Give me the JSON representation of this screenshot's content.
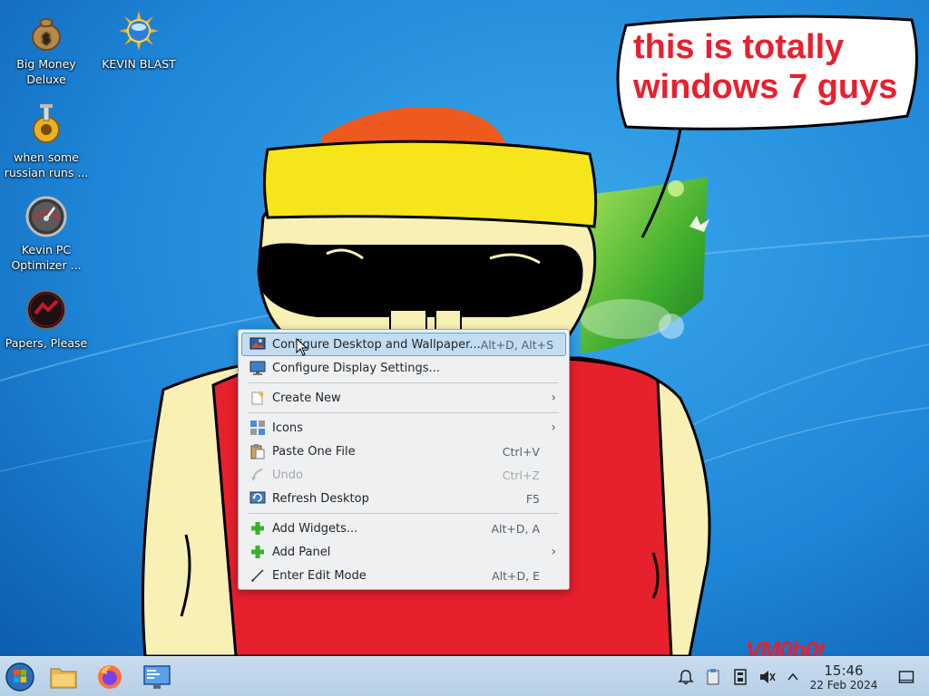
{
  "speech_bubble": {
    "line1": "this is totally",
    "line2": "windows 7 guys"
  },
  "watermark": "VM0b0t",
  "desktop_icons": [
    {
      "label": "Big Money Deluxe",
      "icon": "money-bag-icon"
    },
    {
      "label": "KEVIN BLAST",
      "icon": "sunburst-icon"
    },
    {
      "label": "when some russian runs ...",
      "icon": "gear-sun-icon"
    },
    {
      "label": "Kevin PC Optimizer ...",
      "icon": "speedometer-icon"
    },
    {
      "label": "Papers, Please",
      "icon": "papers-please-icon"
    }
  ],
  "context_menu": {
    "items": [
      {
        "label": "Configure Desktop and Wallpaper...",
        "shortcut": "Alt+D, Alt+S",
        "icon": "desktop-wallpaper-icon",
        "highlighted": true
      },
      {
        "label": "Configure Display Settings...",
        "shortcut": "",
        "icon": "display-icon"
      },
      {
        "label": "Create New",
        "shortcut": "",
        "icon": "new-sparkle-icon",
        "submenu": true
      },
      {
        "label": "Icons",
        "shortcut": "",
        "icon": "icons-grid-icon",
        "submenu": true
      },
      {
        "label": "Paste One File",
        "shortcut": "Ctrl+V",
        "icon": "paste-icon"
      },
      {
        "label": "Undo",
        "shortcut": "Ctrl+Z",
        "icon": "undo-icon",
        "disabled": true
      },
      {
        "label": "Refresh Desktop",
        "shortcut": "F5",
        "icon": "refresh-icon"
      },
      {
        "label": "Add Widgets...",
        "shortcut": "Alt+D, A",
        "icon": "add-icon"
      },
      {
        "label": "Add Panel",
        "shortcut": "",
        "icon": "add-icon",
        "submenu": true
      },
      {
        "label": "Enter Edit Mode",
        "shortcut": "Alt+D, E",
        "icon": "edit-icon"
      }
    ]
  },
  "taskbar": {
    "apps": [
      {
        "name": "start-orb-icon"
      },
      {
        "name": "file-manager-icon"
      },
      {
        "name": "firefox-icon"
      },
      {
        "name": "system-settings-icon"
      }
    ],
    "tray": [
      {
        "name": "notifications-icon"
      },
      {
        "name": "clipboard-icon"
      },
      {
        "name": "storage-icon"
      },
      {
        "name": "volume-muted-icon"
      },
      {
        "name": "chevron-up-icon"
      }
    ],
    "clock": {
      "time": "15:46",
      "date": "22 Feb 2024"
    }
  },
  "colors": {
    "menu_highlight": "#c2dcf1",
    "menu_highlight_border": "#3daee9",
    "bubble_text": "#e8202e",
    "desktop_blue": "#1a7fd4"
  }
}
